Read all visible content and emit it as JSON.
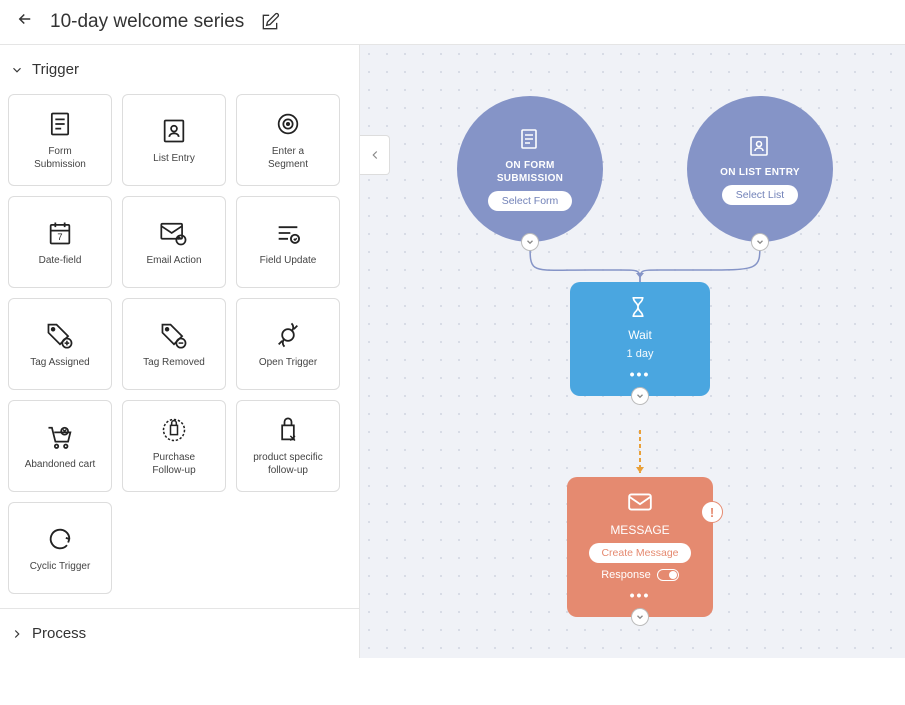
{
  "header": {
    "title": "10-day welcome series"
  },
  "sidebar": {
    "sections": {
      "trigger": {
        "label": "Trigger",
        "items": [
          {
            "label": "Form\nSubmission",
            "icon": "form-icon"
          },
          {
            "label": "List Entry",
            "icon": "list-entry-icon"
          },
          {
            "label": "Enter a\nSegment",
            "icon": "segment-icon"
          },
          {
            "label": "Date-field",
            "icon": "date-icon"
          },
          {
            "label": "Email Action",
            "icon": "email-action-icon"
          },
          {
            "label": "Field Update",
            "icon": "field-update-icon"
          },
          {
            "label": "Tag Assigned",
            "icon": "tag-add-icon"
          },
          {
            "label": "Tag Removed",
            "icon": "tag-remove-icon"
          },
          {
            "label": "Open Trigger",
            "icon": "open-trigger-icon"
          },
          {
            "label": "Abandoned cart",
            "icon": "cart-icon"
          },
          {
            "label": "Purchase\nFollow-up",
            "icon": "purchase-icon"
          },
          {
            "label": "product specific\nfollow-up",
            "icon": "product-icon"
          },
          {
            "label": "Cyclic Trigger",
            "icon": "cyclic-icon"
          }
        ]
      },
      "process": {
        "label": "Process"
      }
    }
  },
  "canvas": {
    "nodes": {
      "form_submission": {
        "title": "ON FORM\nSUBMISSION",
        "action": "Select Form"
      },
      "list_entry": {
        "title": "ON LIST ENTRY",
        "action": "Select List"
      },
      "wait": {
        "title": "Wait",
        "subtitle": "1 day"
      },
      "message": {
        "title": "MESSAGE",
        "action": "Create Message",
        "response_label": "Response"
      }
    }
  },
  "colors": {
    "trigger_node": "#8594c7",
    "wait_node": "#4aa6e0",
    "message_node": "#e58a70"
  }
}
